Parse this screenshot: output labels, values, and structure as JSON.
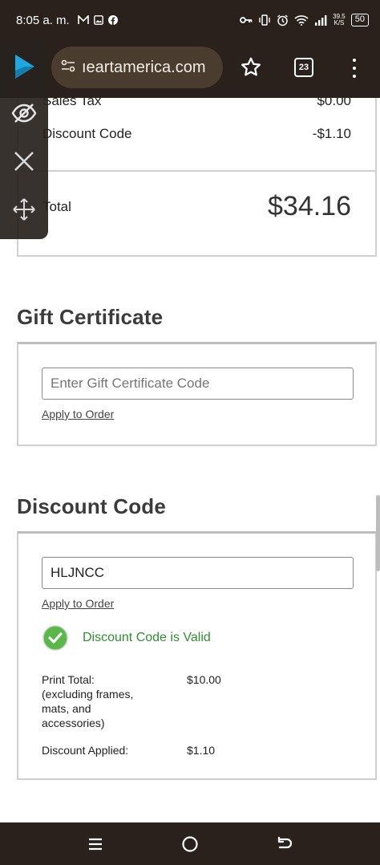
{
  "status_bar": {
    "time": "8:05 a. m.",
    "network_speed_value": "39.5",
    "network_speed_unit": "K/S",
    "battery": "50"
  },
  "browser": {
    "url": "ıeartamerica.com",
    "tab_count": "23"
  },
  "order_summary": {
    "sales_tax_label": "Sales Tax",
    "sales_tax_value": "$0.00",
    "discount_label": "Discount Code",
    "discount_value": "-$1.10",
    "total_label": "Total",
    "total_value": "$34.16"
  },
  "gift_certificate": {
    "title": "Gift Certificate",
    "input_placeholder": "Enter Gift Certificate Code",
    "apply_label": "Apply to Order"
  },
  "discount_code": {
    "title": "Discount Code",
    "input_value": "HLJNCC",
    "apply_label": "Apply to Order",
    "valid_message": "Discount Code is Valid",
    "print_total_label": "Print Total:",
    "print_total_note_1": "(excluding frames,",
    "print_total_note_2": "mats, and",
    "print_total_note_3": "accessories)",
    "print_total_value": "$10.00",
    "discount_applied_label": "Discount Applied:",
    "discount_applied_value": "$1.10"
  },
  "colors": {
    "system_bar": "#2a211c",
    "url_pill": "#4a3d30",
    "valid_green": "#2f8f2f",
    "border_gray": "#cfcfcf"
  },
  "icons": [
    "mail-icon",
    "image-icon",
    "facebook-icon",
    "key-icon",
    "vibrate-icon",
    "alarm-icon",
    "wifi-icon",
    "signal-icon",
    "battery-icon",
    "bubble-app-icon",
    "hide-eye-icon",
    "close-icon",
    "move-icon",
    "tune-icon",
    "star-icon",
    "tab-switcher-icon",
    "more-vert-icon",
    "check-circle-icon",
    "recents-icon",
    "home-icon",
    "back-icon"
  ]
}
